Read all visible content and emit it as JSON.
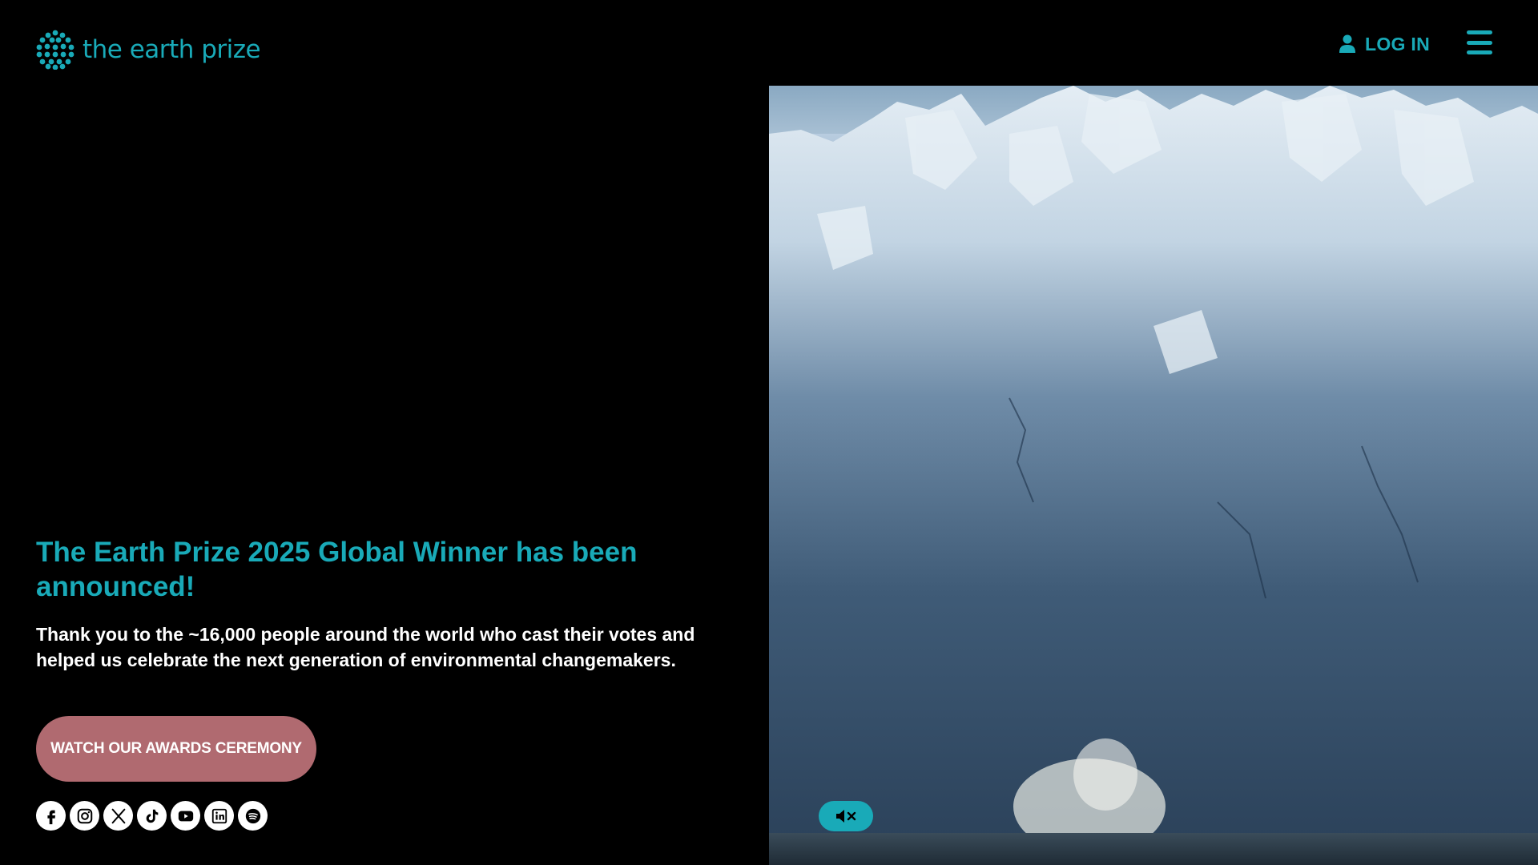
{
  "header": {
    "logo_text": "the earth prize",
    "login_label": "LOG IN"
  },
  "hero": {
    "headline": "The Earth Prize 2025 Global Winner has been announced!",
    "subtext": "Thank you to the ~16,000 people around the world who cast their votes and helped us celebrate the next generation of environmental changemakers.",
    "cta_label": "WATCH OUR AWARDS CEREMONY"
  },
  "socials": [
    {
      "icon": "facebook-icon"
    },
    {
      "icon": "instagram-icon"
    },
    {
      "icon": "x-icon"
    },
    {
      "icon": "tiktok-icon"
    },
    {
      "icon": "youtube-icon"
    },
    {
      "icon": "linkedin-icon"
    },
    {
      "icon": "spotify-icon"
    }
  ],
  "video": {
    "mute_icon": "muted-speaker-icon"
  },
  "colors": {
    "accent": "#19aab8",
    "cta_background": "#b06a70",
    "background": "#000000",
    "text": "#ffffff"
  }
}
